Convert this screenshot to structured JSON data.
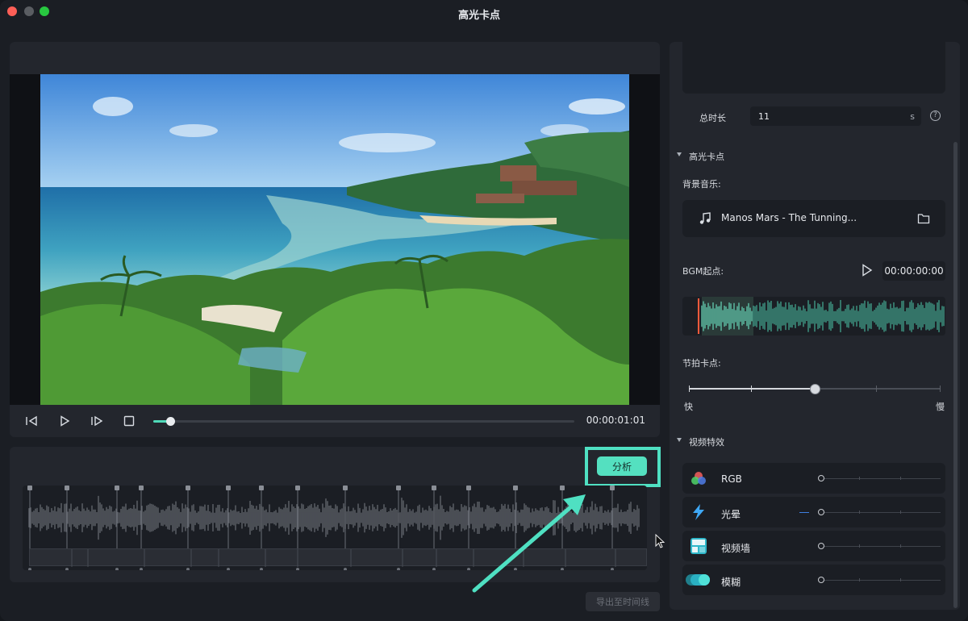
{
  "window": {
    "title": "高光卡点"
  },
  "player": {
    "timecode": "00:00:01:01",
    "progress": 0.04
  },
  "analysis": {
    "analyze_label": "分析",
    "export_label": "导出至时间线"
  },
  "settings": {
    "total_duration_label": "总时长",
    "total_duration_value": "11",
    "total_duration_unit": "s",
    "help_glyph": "?",
    "highlight_section": "高光卡点",
    "bgm_label": "背景音乐:",
    "music_title": "Manos Mars - The Tunning...",
    "bgm_start_label": "BGM起点:",
    "bgm_start_time": "00:00:00:00",
    "beat_label": "节拍卡点:",
    "beat_fast": "快",
    "beat_slow": "慢",
    "beat_level": 0.5,
    "effects_section": "视频特效",
    "effects": [
      {
        "name": "RGB",
        "icon": "rgb-icon"
      },
      {
        "name": "光晕",
        "icon": "glow-icon"
      },
      {
        "name": "视频墙",
        "icon": "video-wall-icon"
      },
      {
        "name": "模糊",
        "icon": "blur-icon"
      }
    ]
  },
  "colors": {
    "accent": "#54e0c0",
    "panel": "#23262d",
    "background": "#1b1e24"
  }
}
